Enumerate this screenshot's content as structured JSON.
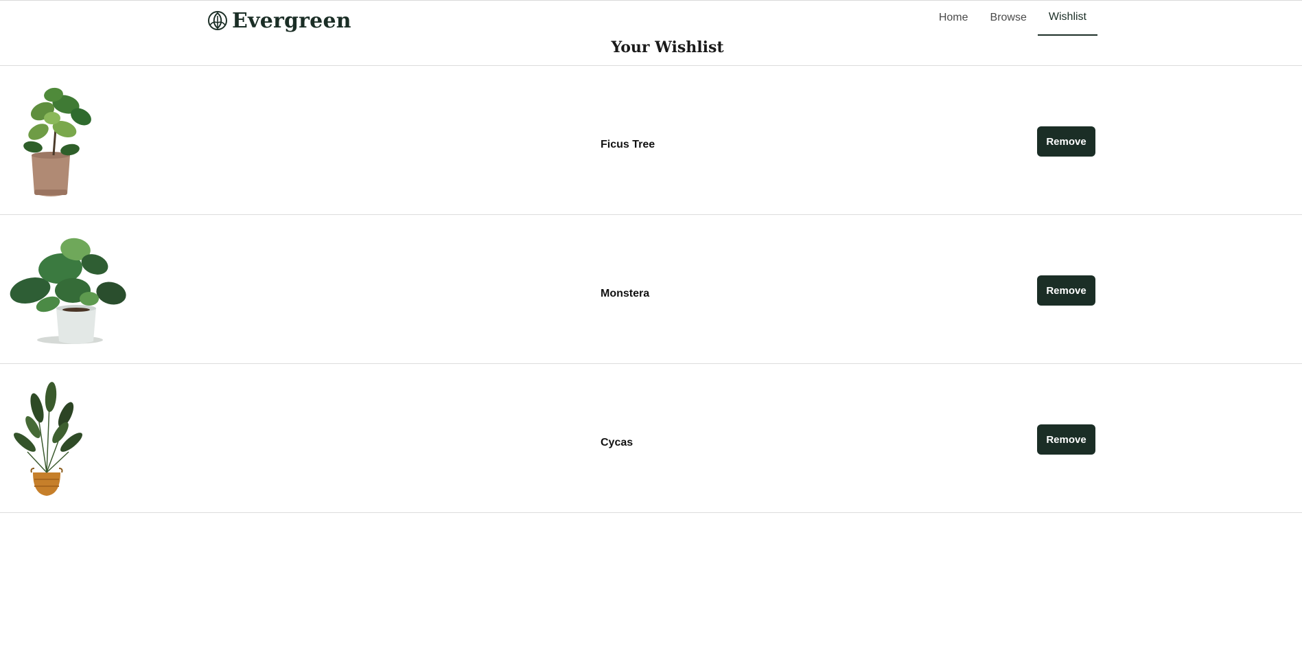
{
  "brand": {
    "name": "Evergreen",
    "color": "#1b2e26"
  },
  "nav": {
    "items": [
      {
        "label": "Home",
        "active": false
      },
      {
        "label": "Browse",
        "active": false
      },
      {
        "label": "Wishlist",
        "active": true
      }
    ]
  },
  "page": {
    "title": "Your Wishlist"
  },
  "wishlist": {
    "items": [
      {
        "name": "Ficus Tree",
        "image_icon": "ficus-plant-image",
        "button_label": "Remove"
      },
      {
        "name": "Monstera",
        "image_icon": "monstera-plant-image",
        "button_label": "Remove"
      },
      {
        "name": "Cycas",
        "image_icon": "cycas-plant-image",
        "button_label": "Remove"
      }
    ]
  }
}
